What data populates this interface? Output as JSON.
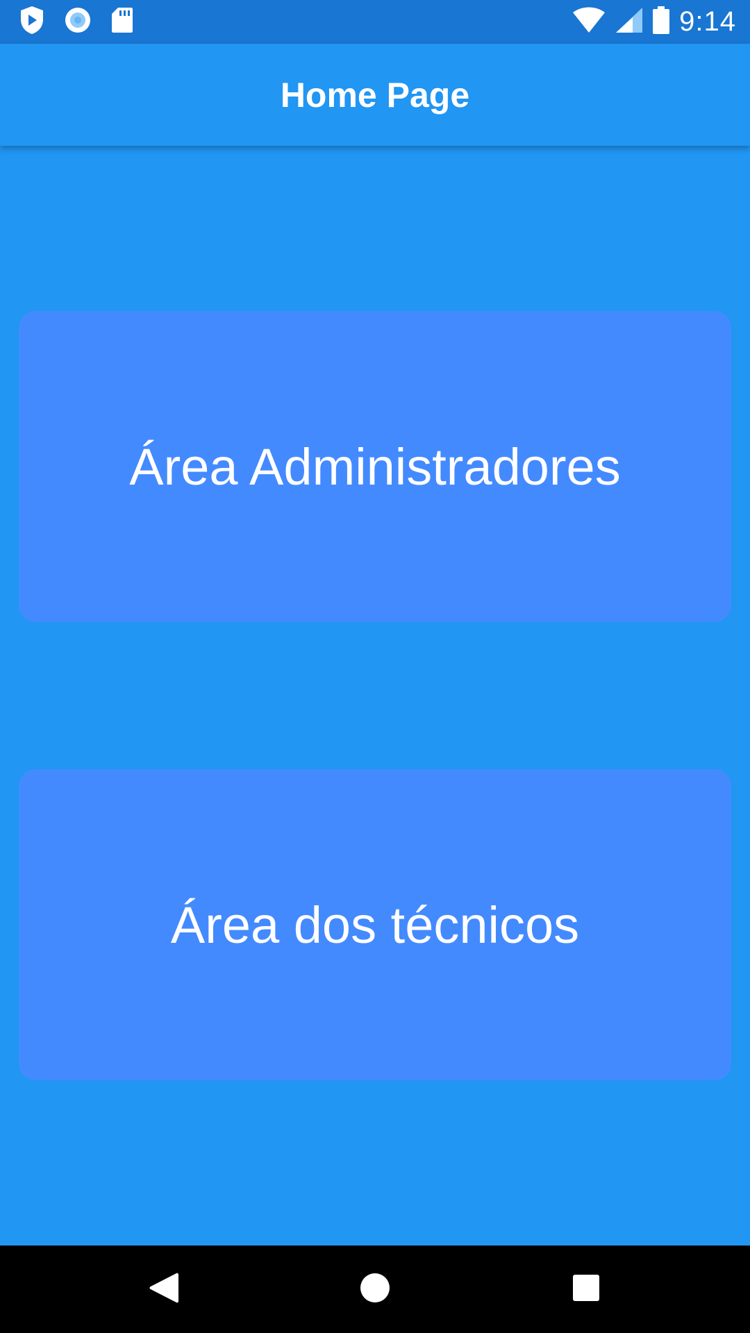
{
  "status_bar": {
    "time": "9:14",
    "left_icons": [
      "play-protect-icon",
      "record-icon",
      "sd-card-icon"
    ],
    "right_icons": [
      "wifi-icon",
      "cell-signal-icon",
      "battery-icon"
    ],
    "background": "#1976D2"
  },
  "app_bar": {
    "title": "Home Page",
    "background": "#2196F3"
  },
  "main": {
    "background": "#2196F3",
    "buttons": [
      {
        "label": "Área Administradores"
      },
      {
        "label": "Área dos técnicos"
      }
    ],
    "button_color": "#448AFF"
  },
  "nav_bar": {
    "icons": [
      "back-icon",
      "home-icon",
      "recents-icon"
    ]
  }
}
